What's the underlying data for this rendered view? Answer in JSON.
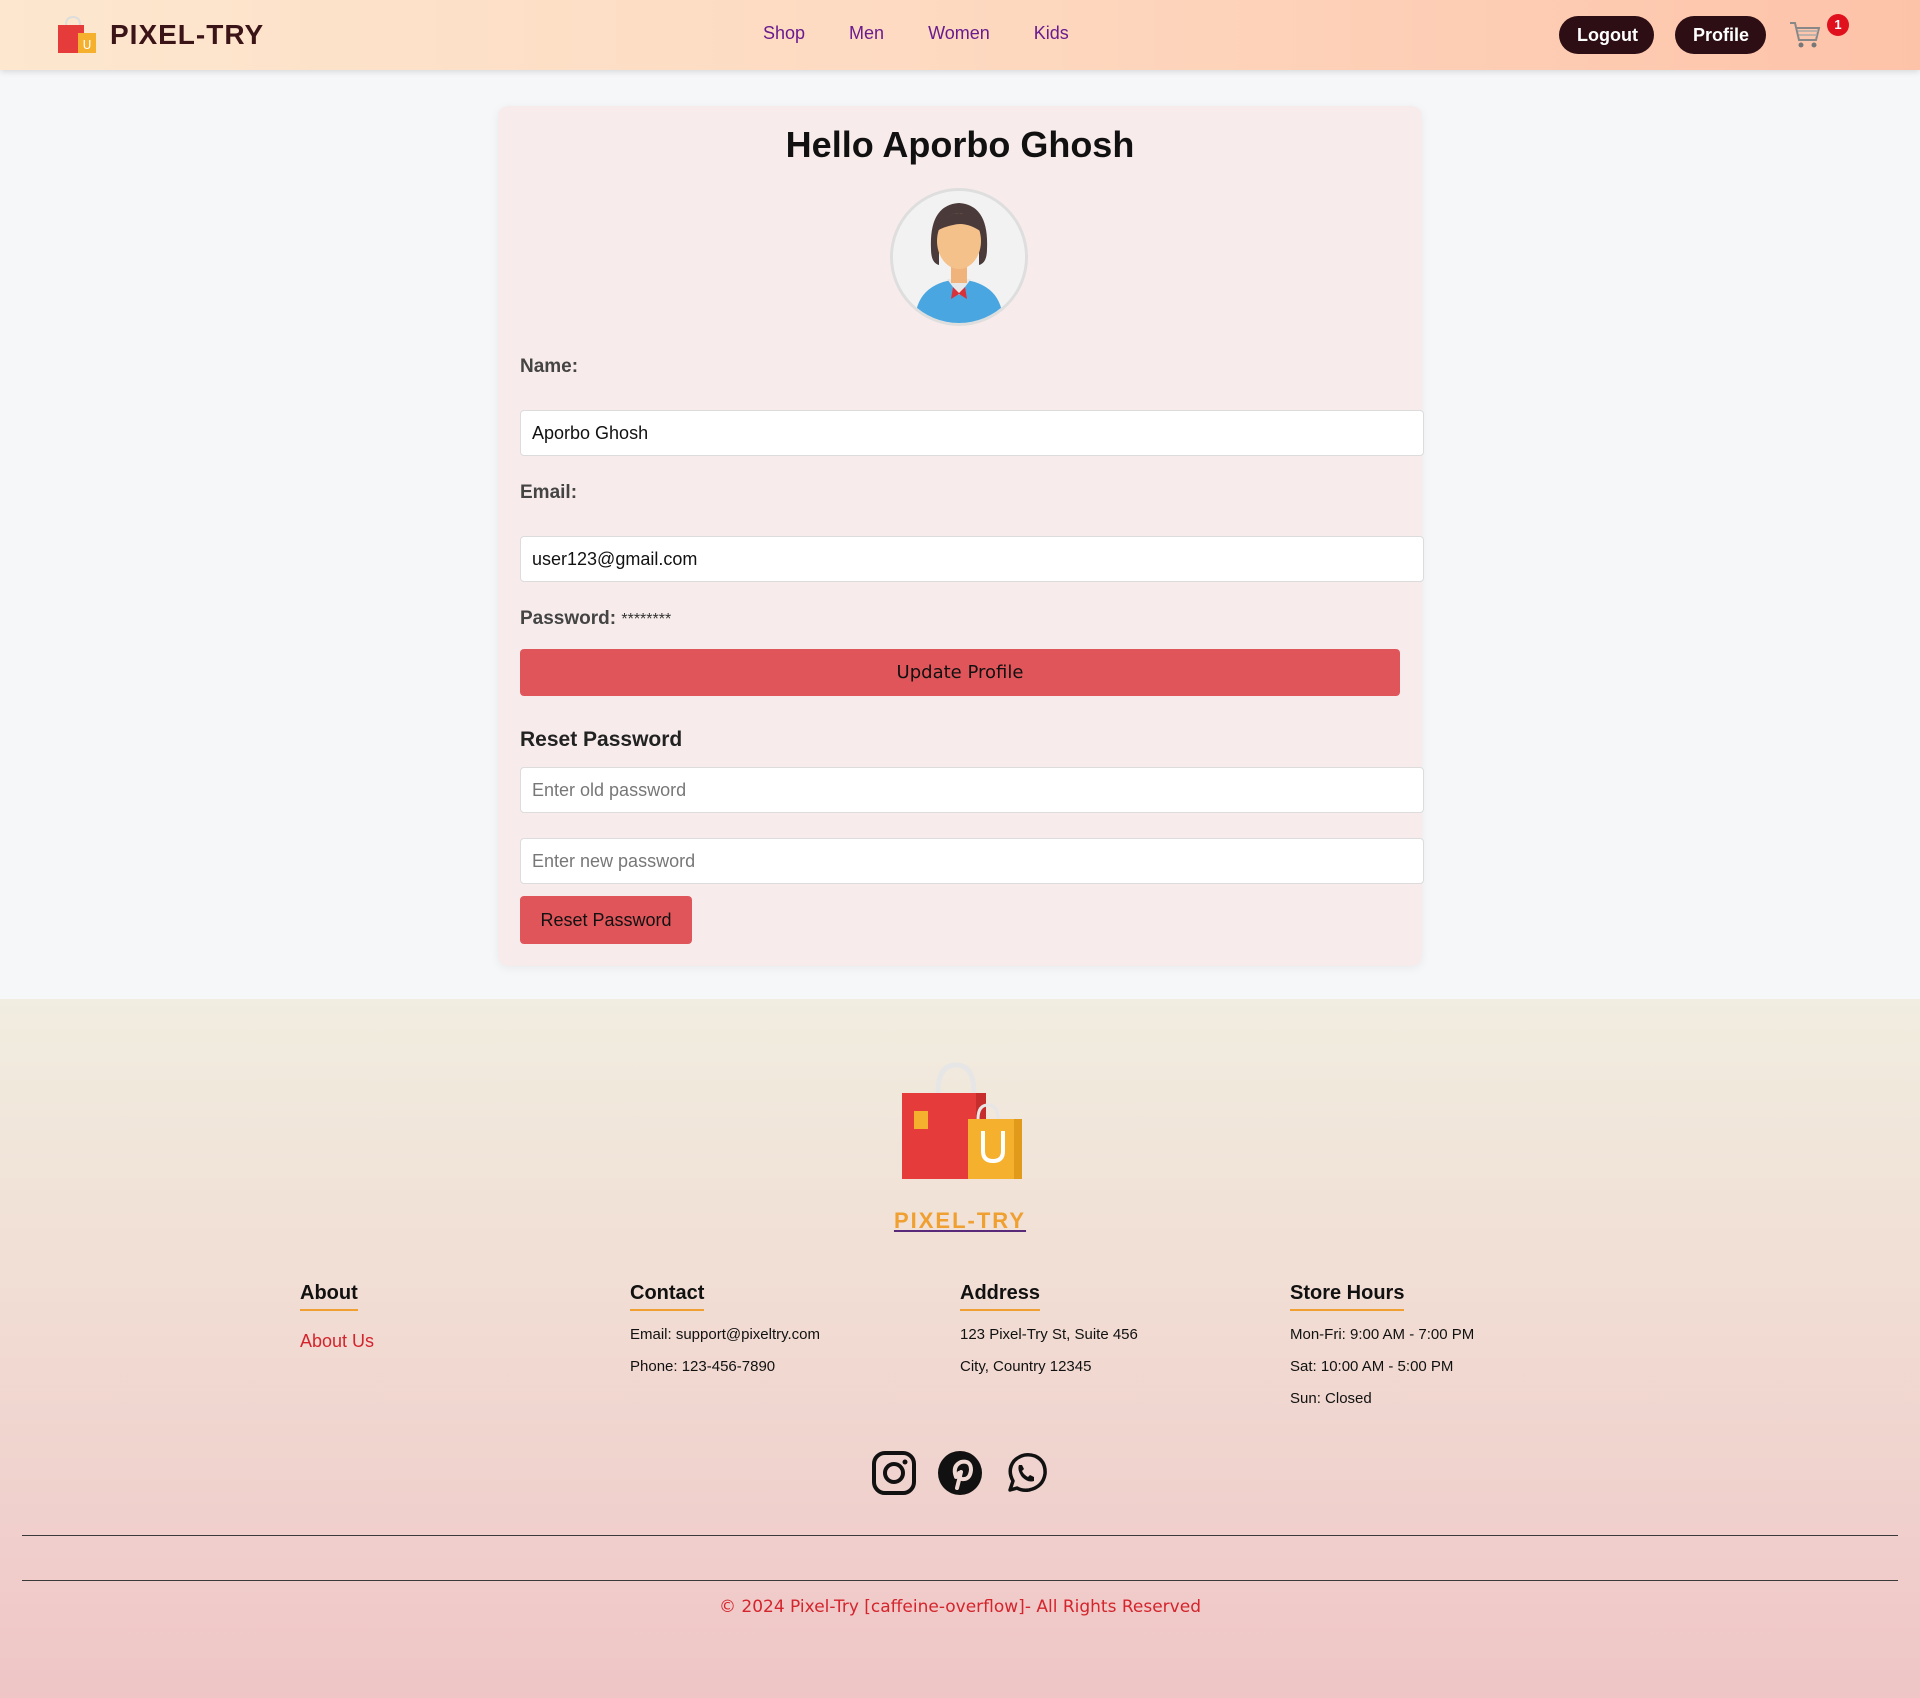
{
  "header": {
    "brand": "PIXEL-TRY",
    "nav": [
      "Shop",
      "Men",
      "Women",
      "Kids"
    ],
    "logout_label": "Logout",
    "profile_label": "Profile",
    "cart_count": "1"
  },
  "profile": {
    "greeting": "Hello Aporbo Ghosh",
    "name_label": "Name:",
    "name_value": "Aporbo Ghosh",
    "email_label": "Email:",
    "email_value": "user123@gmail.com",
    "password_label": "Password:",
    "password_mask": "********",
    "update_label": "Update Profile",
    "reset_title": "Reset Password",
    "old_password_placeholder": "Enter old password",
    "new_password_placeholder": "Enter new password",
    "reset_label": "Reset Password"
  },
  "footer": {
    "brand": "PIXEL-TRY",
    "about": {
      "title": "About",
      "link": "About Us"
    },
    "contact": {
      "title": "Contact",
      "lines": [
        "Email: support@pixeltry.com",
        "Phone: 123-456-7890"
      ]
    },
    "address": {
      "title": "Address",
      "lines": [
        "123 Pixel-Try St, Suite 456",
        "City, Country 12345"
      ]
    },
    "hours": {
      "title": "Store Hours",
      "lines": [
        "Mon-Fri: 9:00 AM - 7:00 PM",
        "Sat: 10:00 AM - 5:00 PM",
        "Sun: Closed"
      ]
    },
    "social_icons": [
      "instagram-icon",
      "pinterest-icon",
      "whatsapp-icon"
    ],
    "copyright": "© 2024 Pixel-Try [caffeine-overflow]- All Rights Reserved"
  },
  "colors": {
    "accent_red": "#e0555a",
    "dark_button": "#2c0e14",
    "nav_link": "#6a1b8e",
    "footer_accent": "#f0a030"
  }
}
